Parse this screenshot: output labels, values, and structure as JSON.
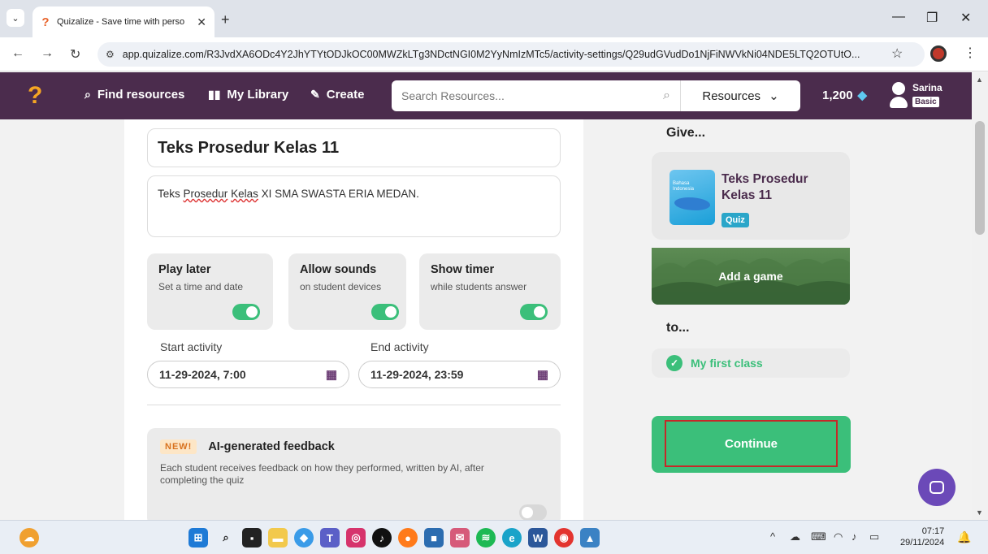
{
  "browser": {
    "tab_title": "Quizalize - Save time with perso",
    "url": "app.quizalize.com/R3JvdXA6ODc4Y2JhYTYtODJkOC00MWZkLTg3NDctNGI0M2YyNmIzMTc5/activity-settings/Q29udGVudDo1NjFiNWVkNi04NDE5LTQ2OTUtO..."
  },
  "app": {
    "nav": {
      "find_resources": "Find resources",
      "my_library": "My Library",
      "create": "Create"
    },
    "search": {
      "placeholder": "Search Resources..."
    },
    "resources_dropdown": "Resources",
    "coins": "1,200",
    "user": {
      "name": "Sarina",
      "plan": "Basic"
    }
  },
  "settings": {
    "title": "Teks Prosedur Kelas 11",
    "description_spell1": "Prosedur",
    "description_spell2": "Kelas",
    "description_prefix": "Teks ",
    "description_suffix": " XI SMA SWASTA ERIA MEDAN.",
    "options": [
      {
        "title": "Play later",
        "subtitle": "Set a time and date",
        "enabled": true
      },
      {
        "title": "Allow sounds",
        "subtitle": "on student devices",
        "enabled": true
      },
      {
        "title": "Show timer",
        "subtitle": "while students answer",
        "enabled": true
      }
    ],
    "start_label": "Start activity",
    "start_value": "11-29-2024, 7:00",
    "end_label": "End activity",
    "end_value": "11-29-2024, 23:59",
    "ai_feedback": {
      "badge": "NEW!",
      "title": "AI-generated feedback",
      "description": "Each student receives feedback on how they performed, written by AI, after completing the quiz",
      "enabled": false
    }
  },
  "sidebar": {
    "give_label": "Give...",
    "quiz": {
      "title": "Teks Prosedur Kelas 11",
      "type": "Quiz",
      "thumb_text1": "Bahasa",
      "thumb_text2": "Indonesia"
    },
    "game_label": "Add a game",
    "to_label": "to...",
    "class_name": "My first class",
    "continue_label": "Continue"
  },
  "taskbar": {
    "time": "07:17",
    "date": "29/11/2024",
    "colors": {
      "accent_purple": "#4b2c4d",
      "accent_green": "#3bbf7a",
      "highlight_red": "#c62828"
    }
  }
}
